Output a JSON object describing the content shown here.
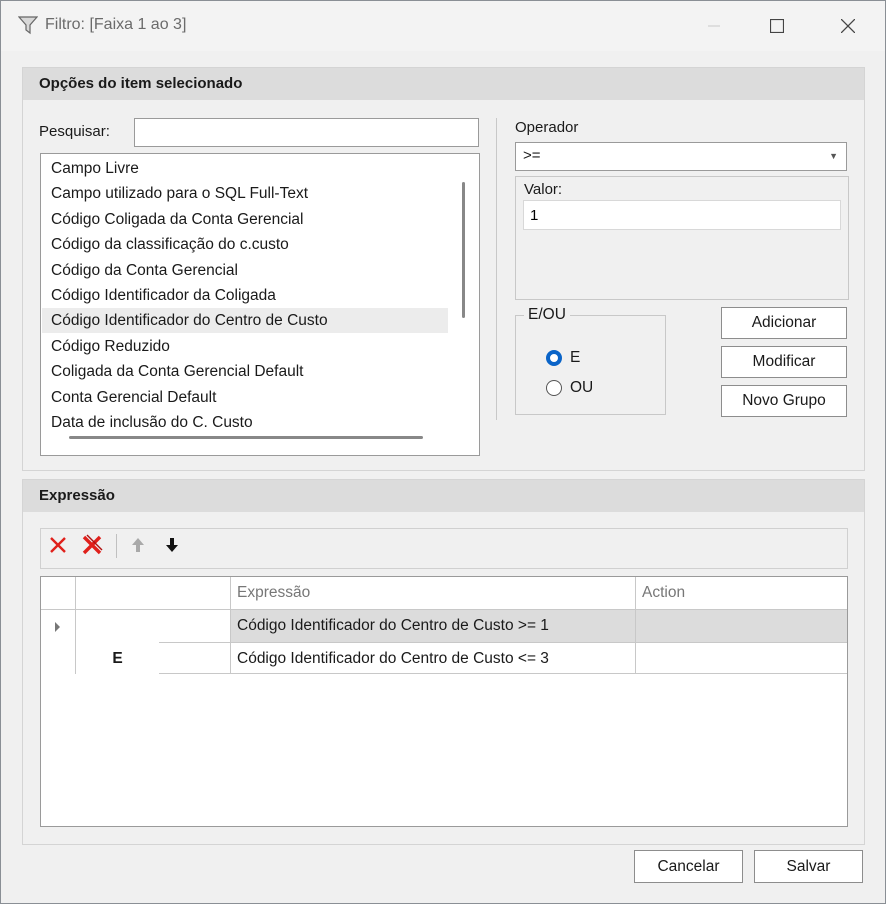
{
  "window": {
    "title": "Filtro: [Faixa 1 ao 3]"
  },
  "options_group": {
    "header": "Opções do item selecionado",
    "search_label": "Pesquisar:",
    "search_value": "",
    "fields": [
      "Campo Livre",
      "Campo utilizado para o SQL Full-Text",
      "Código Coligada da Conta Gerencial",
      "Código da classificação do c.custo",
      "Código da Conta Gerencial",
      "Código Identificador da Coligada",
      "Código Identificador do Centro de Custo",
      "Código Reduzido",
      "Coligada da Conta Gerencial Default",
      "Conta Gerencial Default",
      "Data de inclusão do C. Custo"
    ],
    "selected_field_index": 6,
    "operator_label": "Operador",
    "operator_value": ">=",
    "value_label": "Valor:",
    "value_value": "1",
    "logic_legend": "E/OU",
    "logic_options": [
      "E",
      "OU"
    ],
    "logic_selected": "E",
    "add_button": "Adicionar",
    "modify_button": "Modificar",
    "new_group_button": "Novo Grupo"
  },
  "expression_group": {
    "header": "Expressão",
    "toolbar": [
      "delete-icon",
      "delete-all-icon",
      "arrow-up-icon",
      "arrow-down-icon"
    ],
    "columns": [
      "Expressão",
      "Action"
    ],
    "rows": [
      {
        "connector": "",
        "expression": "Código Identificador do Centro de Custo >= 1",
        "action": "",
        "selected": true
      },
      {
        "connector": "E",
        "expression": "Código Identificador do Centro de Custo <= 3",
        "action": "",
        "selected": false
      }
    ]
  },
  "footer": {
    "cancel_button": "Cancelar",
    "save_button": "Salvar"
  },
  "colors": {
    "accent": "#0a64c8",
    "delete_red": "#e0201b"
  }
}
